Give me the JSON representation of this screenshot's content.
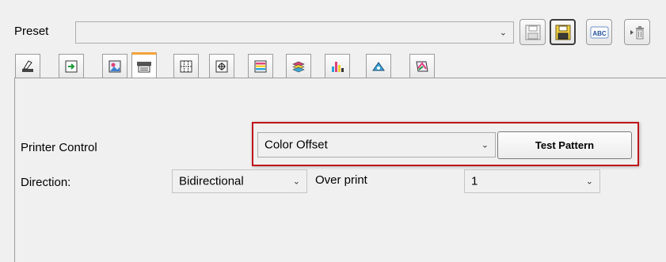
{
  "preset": {
    "label": "Preset",
    "value": "",
    "buttons": [
      {
        "name": "save-preset-button",
        "icon": "floppy-disk-icon"
      },
      {
        "name": "save-as-preset-button",
        "icon": "floppy-disk-yellow-icon"
      },
      {
        "name": "rename-preset-button",
        "icon": "abc-icon",
        "text": "ABC"
      },
      {
        "name": "delete-preset-button",
        "icon": "trash-icon"
      }
    ]
  },
  "tabs": [
    {
      "name": "tab-media",
      "icon": "media-icon"
    },
    {
      "name": "tab-layout",
      "icon": "layout-icon"
    },
    {
      "name": "tab-image",
      "icon": "image-icon"
    },
    {
      "name": "tab-printer-control",
      "icon": "printer-icon",
      "selected": true
    },
    {
      "name": "tab-tiling",
      "icon": "tiling-icon"
    },
    {
      "name": "tab-registration",
      "icon": "registration-icon"
    },
    {
      "name": "tab-color-bars",
      "icon": "color-bars-icon"
    },
    {
      "name": "tab-layers",
      "icon": "layers-icon"
    },
    {
      "name": "tab-ink-levels",
      "icon": "ink-levels-icon"
    },
    {
      "name": "tab-cutting",
      "icon": "cutting-icon"
    },
    {
      "name": "tab-color-management",
      "icon": "color-management-icon"
    }
  ],
  "printer_control": {
    "label": "Printer Control",
    "value": "Color Offset",
    "test_pattern_label": "Test Pattern"
  },
  "direction": {
    "label": "Direction:",
    "value": "Bidirectional"
  },
  "over_print": {
    "label": "Over print",
    "value": "1"
  },
  "colors": {
    "highlight": "#c0141c",
    "selected_tab": "#f3a33a"
  }
}
